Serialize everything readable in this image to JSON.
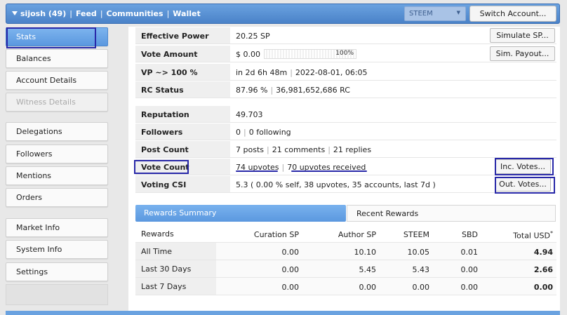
{
  "topbar": {
    "user": "sijosh (49)",
    "nav": [
      "Feed",
      "Communities",
      "Wallet"
    ],
    "chain": "STEEM",
    "switch_account": "Switch Account..."
  },
  "sidebar": {
    "groups": [
      [
        {
          "label": "Stats",
          "state": "active"
        },
        {
          "label": "Balances"
        },
        {
          "label": "Account Details"
        },
        {
          "label": "Witness Details",
          "state": "disabled"
        }
      ],
      [
        {
          "label": "Delegations"
        },
        {
          "label": "Followers"
        },
        {
          "label": "Mentions"
        },
        {
          "label": "Orders"
        }
      ],
      [
        {
          "label": "Market Info"
        },
        {
          "label": "System Info"
        },
        {
          "label": "Settings"
        }
      ]
    ]
  },
  "stats": {
    "effective_power": {
      "label": "Effective Power",
      "value": "20.25 SP",
      "button": "Simulate SP..."
    },
    "vote_amount": {
      "label": "Vote Amount",
      "value": "$ 0.00",
      "percent": "100%",
      "button": "Sim. Payout..."
    },
    "vp": {
      "label": "VP ~> 100 %",
      "value_a": "in 2d 6h 48m",
      "value_b": "2022-08-01, 06:05"
    },
    "rc_status": {
      "label": "RC Status",
      "value_a": "87.96 %",
      "value_b": "36,981,652,686 RC"
    },
    "reputation": {
      "label": "Reputation",
      "value": "49.703"
    },
    "followers": {
      "label": "Followers",
      "value_a": "0",
      "value_b": "0 following"
    },
    "post_count": {
      "label": "Post Count",
      "value_a": "7 posts",
      "value_b": "21 comments",
      "value_c": "21 replies"
    },
    "vote_count": {
      "label": "Vote Count",
      "value_a": "74 upvotes",
      "value_b": "70 upvotes received",
      "button": "Inc. Votes..."
    },
    "voting_csi": {
      "label": "Voting CSI",
      "value": "5.3 ( 0.00 % self, 38 upvotes, 35 accounts, last 7d )",
      "button": "Out. Votes..."
    }
  },
  "rewards": {
    "tab_active": "Rewards Summary",
    "tab_inactive": "Recent Rewards",
    "headers": [
      "Rewards",
      "Curation SP",
      "Author SP",
      "STEEM",
      "SBD",
      "Total USD"
    ],
    "total_marker": "*",
    "rows": [
      {
        "label": "All Time",
        "values": [
          "0.00",
          "10.10",
          "10.05",
          "0.01",
          "4.94"
        ]
      },
      {
        "label": "Last 30 Days",
        "values": [
          "0.00",
          "5.45",
          "5.43",
          "0.00",
          "2.66"
        ]
      },
      {
        "label": "Last 7 Days",
        "values": [
          "0.00",
          "0.00",
          "0.00",
          "0.00",
          "0.00"
        ]
      }
    ]
  },
  "colors": {
    "accent": "#5b98df",
    "annotation": "#2828a8"
  }
}
